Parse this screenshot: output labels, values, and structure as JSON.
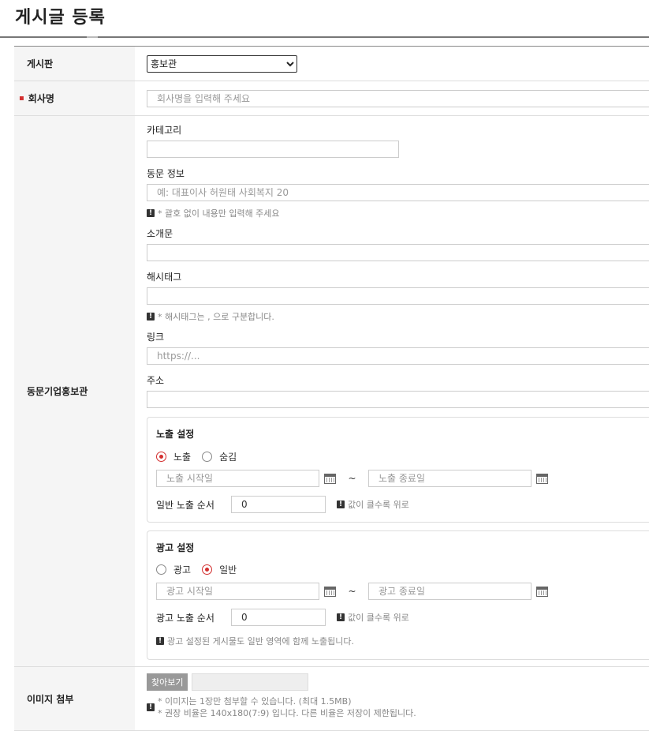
{
  "page": {
    "title": "게시글 등록"
  },
  "board": {
    "label": "게시판",
    "selected": "홍보관"
  },
  "company": {
    "label": "회사명",
    "required_mark": "▪",
    "placeholder": "회사명을 입력해 주세요"
  },
  "promo": {
    "label": "동문기업홍보관",
    "category_label": "카테고리",
    "alumni_label": "동문 정보",
    "alumni_placeholder": "예: 대표이사 허원태 사회복지 20",
    "alumni_note": "* 괄호 없이 내용만 입력해 주세요",
    "intro_label": "소개문",
    "hashtag_label": "해시태그",
    "hashtag_note": "* 해시태그는 , 으로 구분합니다.",
    "link_label": "링크",
    "link_placeholder": "https://...",
    "address_label": "주소"
  },
  "exposure": {
    "title": "노출 설정",
    "option_show": "노출",
    "option_hide": "숨김",
    "start_placeholder": "노출 시작일",
    "end_placeholder": "노출 종료일",
    "tilde": "~",
    "order_label": "일반 노출 순서",
    "order_value": "0",
    "order_note": "값이 클수록 위로",
    "selected": "노출"
  },
  "ad": {
    "title": "광고 설정",
    "option_ad": "광고",
    "option_normal": "일반",
    "start_placeholder": "광고 시작일",
    "end_placeholder": "광고 종료일",
    "tilde": "~",
    "order_label": "광고 노출 순서",
    "order_value": "0",
    "order_note": "값이 클수록 위로",
    "notice": "광고 설정된 게시물도 일반 영역에 함께 노출됩니다.",
    "selected": "일반"
  },
  "image": {
    "label": "이미지 첨부",
    "browse_button": "찾아보기",
    "note_line1": "* 이미지는 1장만 첨부할 수 있습니다. (최대 1.5MB)",
    "note_line2": "* 권장 비율은 140x180(7:9) 입니다. 다른 비율은 저장이 제한됩니다."
  },
  "icons": {
    "notice": "notice-icon",
    "calendar": "calendar-icon"
  },
  "colors": {
    "required": "#d32f2f",
    "radio_selected": "#d32f2f",
    "header_bg": "#f5f5f5"
  }
}
